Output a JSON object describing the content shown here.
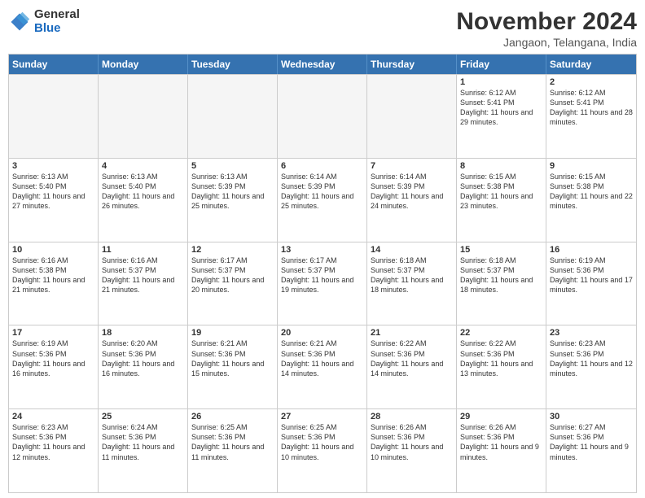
{
  "logo": {
    "general": "General",
    "blue": "Blue"
  },
  "title": "November 2024",
  "location": "Jangaon, Telangana, India",
  "days": [
    "Sunday",
    "Monday",
    "Tuesday",
    "Wednesday",
    "Thursday",
    "Friday",
    "Saturday"
  ],
  "rows": [
    [
      {
        "day": "",
        "empty": true
      },
      {
        "day": "",
        "empty": true
      },
      {
        "day": "",
        "empty": true
      },
      {
        "day": "",
        "empty": true
      },
      {
        "day": "",
        "empty": true
      },
      {
        "day": "1",
        "sunrise": "Sunrise: 6:12 AM",
        "sunset": "Sunset: 5:41 PM",
        "daylight": "Daylight: 11 hours and 29 minutes."
      },
      {
        "day": "2",
        "sunrise": "Sunrise: 6:12 AM",
        "sunset": "Sunset: 5:41 PM",
        "daylight": "Daylight: 11 hours and 28 minutes."
      }
    ],
    [
      {
        "day": "3",
        "sunrise": "Sunrise: 6:13 AM",
        "sunset": "Sunset: 5:40 PM",
        "daylight": "Daylight: 11 hours and 27 minutes."
      },
      {
        "day": "4",
        "sunrise": "Sunrise: 6:13 AM",
        "sunset": "Sunset: 5:40 PM",
        "daylight": "Daylight: 11 hours and 26 minutes."
      },
      {
        "day": "5",
        "sunrise": "Sunrise: 6:13 AM",
        "sunset": "Sunset: 5:39 PM",
        "daylight": "Daylight: 11 hours and 25 minutes."
      },
      {
        "day": "6",
        "sunrise": "Sunrise: 6:14 AM",
        "sunset": "Sunset: 5:39 PM",
        "daylight": "Daylight: 11 hours and 25 minutes."
      },
      {
        "day": "7",
        "sunrise": "Sunrise: 6:14 AM",
        "sunset": "Sunset: 5:39 PM",
        "daylight": "Daylight: 11 hours and 24 minutes."
      },
      {
        "day": "8",
        "sunrise": "Sunrise: 6:15 AM",
        "sunset": "Sunset: 5:38 PM",
        "daylight": "Daylight: 11 hours and 23 minutes."
      },
      {
        "day": "9",
        "sunrise": "Sunrise: 6:15 AM",
        "sunset": "Sunset: 5:38 PM",
        "daylight": "Daylight: 11 hours and 22 minutes."
      }
    ],
    [
      {
        "day": "10",
        "sunrise": "Sunrise: 6:16 AM",
        "sunset": "Sunset: 5:38 PM",
        "daylight": "Daylight: 11 hours and 21 minutes."
      },
      {
        "day": "11",
        "sunrise": "Sunrise: 6:16 AM",
        "sunset": "Sunset: 5:37 PM",
        "daylight": "Daylight: 11 hours and 21 minutes."
      },
      {
        "day": "12",
        "sunrise": "Sunrise: 6:17 AM",
        "sunset": "Sunset: 5:37 PM",
        "daylight": "Daylight: 11 hours and 20 minutes."
      },
      {
        "day": "13",
        "sunrise": "Sunrise: 6:17 AM",
        "sunset": "Sunset: 5:37 PM",
        "daylight": "Daylight: 11 hours and 19 minutes."
      },
      {
        "day": "14",
        "sunrise": "Sunrise: 6:18 AM",
        "sunset": "Sunset: 5:37 PM",
        "daylight": "Daylight: 11 hours and 18 minutes."
      },
      {
        "day": "15",
        "sunrise": "Sunrise: 6:18 AM",
        "sunset": "Sunset: 5:37 PM",
        "daylight": "Daylight: 11 hours and 18 minutes."
      },
      {
        "day": "16",
        "sunrise": "Sunrise: 6:19 AM",
        "sunset": "Sunset: 5:36 PM",
        "daylight": "Daylight: 11 hours and 17 minutes."
      }
    ],
    [
      {
        "day": "17",
        "sunrise": "Sunrise: 6:19 AM",
        "sunset": "Sunset: 5:36 PM",
        "daylight": "Daylight: 11 hours and 16 minutes."
      },
      {
        "day": "18",
        "sunrise": "Sunrise: 6:20 AM",
        "sunset": "Sunset: 5:36 PM",
        "daylight": "Daylight: 11 hours and 16 minutes."
      },
      {
        "day": "19",
        "sunrise": "Sunrise: 6:21 AM",
        "sunset": "Sunset: 5:36 PM",
        "daylight": "Daylight: 11 hours and 15 minutes."
      },
      {
        "day": "20",
        "sunrise": "Sunrise: 6:21 AM",
        "sunset": "Sunset: 5:36 PM",
        "daylight": "Daylight: 11 hours and 14 minutes."
      },
      {
        "day": "21",
        "sunrise": "Sunrise: 6:22 AM",
        "sunset": "Sunset: 5:36 PM",
        "daylight": "Daylight: 11 hours and 14 minutes."
      },
      {
        "day": "22",
        "sunrise": "Sunrise: 6:22 AM",
        "sunset": "Sunset: 5:36 PM",
        "daylight": "Daylight: 11 hours and 13 minutes."
      },
      {
        "day": "23",
        "sunrise": "Sunrise: 6:23 AM",
        "sunset": "Sunset: 5:36 PM",
        "daylight": "Daylight: 11 hours and 12 minutes."
      }
    ],
    [
      {
        "day": "24",
        "sunrise": "Sunrise: 6:23 AM",
        "sunset": "Sunset: 5:36 PM",
        "daylight": "Daylight: 11 hours and 12 minutes."
      },
      {
        "day": "25",
        "sunrise": "Sunrise: 6:24 AM",
        "sunset": "Sunset: 5:36 PM",
        "daylight": "Daylight: 11 hours and 11 minutes."
      },
      {
        "day": "26",
        "sunrise": "Sunrise: 6:25 AM",
        "sunset": "Sunset: 5:36 PM",
        "daylight": "Daylight: 11 hours and 11 minutes."
      },
      {
        "day": "27",
        "sunrise": "Sunrise: 6:25 AM",
        "sunset": "Sunset: 5:36 PM",
        "daylight": "Daylight: 11 hours and 10 minutes."
      },
      {
        "day": "28",
        "sunrise": "Sunrise: 6:26 AM",
        "sunset": "Sunset: 5:36 PM",
        "daylight": "Daylight: 11 hours and 10 minutes."
      },
      {
        "day": "29",
        "sunrise": "Sunrise: 6:26 AM",
        "sunset": "Sunset: 5:36 PM",
        "daylight": "Daylight: 11 hours and 9 minutes."
      },
      {
        "day": "30",
        "sunrise": "Sunrise: 6:27 AM",
        "sunset": "Sunset: 5:36 PM",
        "daylight": "Daylight: 11 hours and 9 minutes."
      }
    ]
  ]
}
